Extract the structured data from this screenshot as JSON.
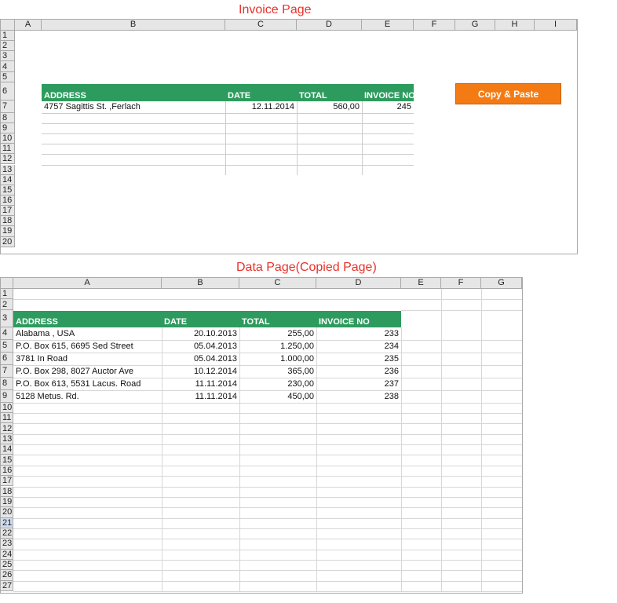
{
  "invoice_page": {
    "caption": "Invoice Page",
    "columns": [
      "A",
      "B",
      "C",
      "D",
      "E",
      "F",
      "G",
      "H",
      "I"
    ],
    "rows": [
      "1",
      "2",
      "3",
      "4",
      "5",
      "6",
      "7",
      "8",
      "9",
      "10",
      "11",
      "12",
      "13",
      "14",
      "15",
      "16",
      "17",
      "18",
      "19",
      "20"
    ],
    "table_headers": [
      "ADDRESS",
      "DATE",
      "TOTAL",
      "INVOICE NO"
    ],
    "table_row": {
      "address": "4757 Sagittis St.  ,Ferlach",
      "date": "12.11.2014",
      "total": "560,00",
      "invoice_no": "245"
    },
    "button_label": "Copy & Paste",
    "colors": {
      "header_green": "#2e9b5e",
      "button_orange": "#f47b14",
      "caption_red": "#e8322a"
    }
  },
  "data_page": {
    "caption": "Data Page(Copied Page)",
    "columns": [
      "A",
      "B",
      "C",
      "D",
      "E",
      "F",
      "G"
    ],
    "rows": [
      "1",
      "2",
      "3",
      "4",
      "5",
      "6",
      "7",
      "8",
      "9",
      "10",
      "11",
      "12",
      "13",
      "14",
      "15",
      "16",
      "17",
      "18",
      "19",
      "20",
      "21",
      "22",
      "23",
      "24",
      "25",
      "26",
      "27"
    ],
    "selected_row": "21",
    "table_headers": [
      "ADDRESS",
      "DATE",
      "TOTAL",
      "INVOICE NO"
    ],
    "table_rows": [
      {
        "address": "Alabama , USA",
        "date": "20.10.2013",
        "total": "255,00",
        "invoice_no": "233"
      },
      {
        "address": "P.O. Box 615, 6695 Sed Street",
        "date": "05.04.2013",
        "total": "1.250,00",
        "invoice_no": "234"
      },
      {
        "address": "3781 In Road",
        "date": "05.04.2013",
        "total": "1.000,00",
        "invoice_no": "235"
      },
      {
        "address": "P.O. Box 298, 8027 Auctor Ave",
        "date": "10.12.2014",
        "total": "365,00",
        "invoice_no": "236"
      },
      {
        "address": "P.O. Box 613, 5531 Lacus. Road",
        "date": "11.11.2014",
        "total": "230,00",
        "invoice_no": "237"
      },
      {
        "address": "5128 Metus. Rd.",
        "date": "11.11.2014",
        "total": "450,00",
        "invoice_no": "238"
      }
    ]
  }
}
